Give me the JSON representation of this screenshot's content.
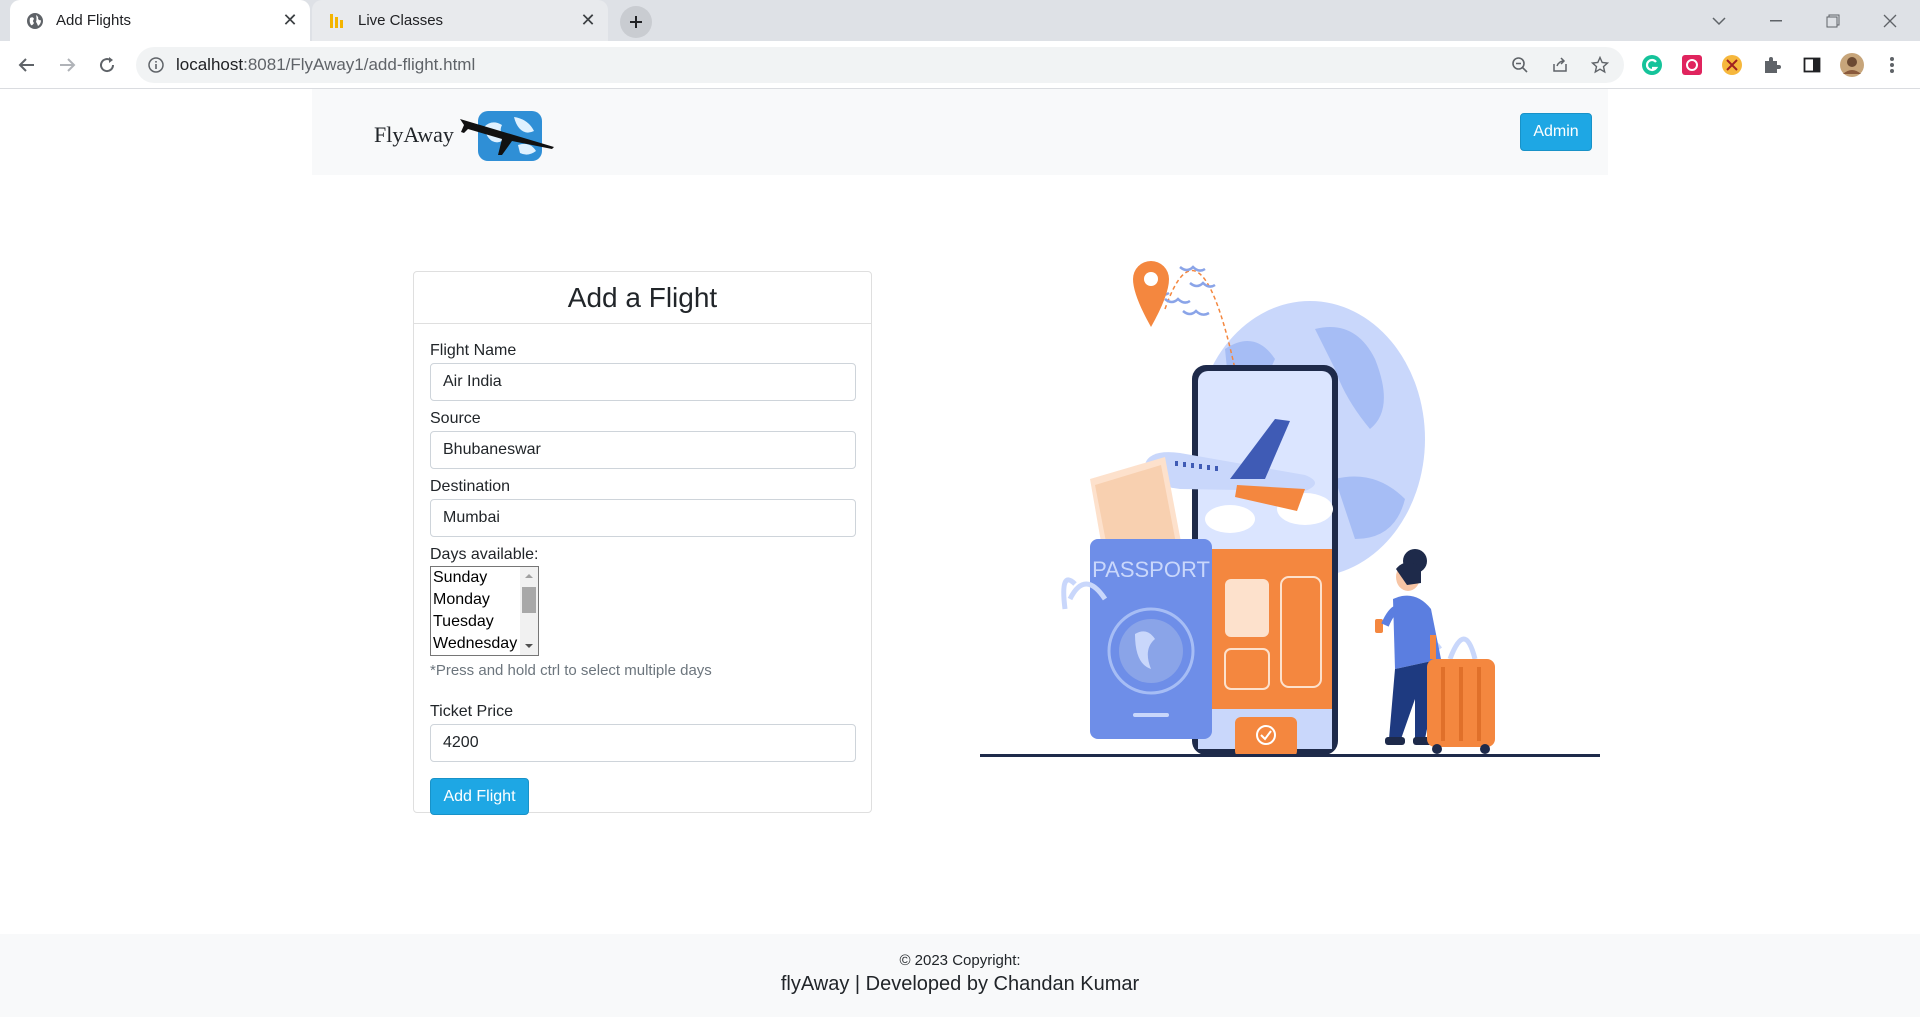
{
  "browser": {
    "tabs": [
      {
        "title": "Add Flights",
        "active": true
      },
      {
        "title": "Live Classes",
        "active": false
      }
    ],
    "url_host": "localhost",
    "url_path": ":8081/FlyAway1/add-flight.html"
  },
  "navbar": {
    "brand": "FlyAway",
    "admin_label": "Admin"
  },
  "form": {
    "title": "Add a Flight",
    "flight_name_label": "Flight Name",
    "flight_name_value": "Air India",
    "source_label": "Source",
    "source_value": "Bhubaneswar",
    "destination_label": "Destination",
    "destination_value": "Mumbai",
    "days_label": "Days available:",
    "days": [
      "Sunday",
      "Monday",
      "Tuesday",
      "Wednesday"
    ],
    "days_hint": "*Press and hold ctrl to select multiple days",
    "price_label": "Ticket Price",
    "price_value": "4200",
    "submit_label": "Add Flight"
  },
  "illustration": {
    "passport_text": "PASSPORT"
  },
  "footer": {
    "copyright": "© 2023 Copyright:",
    "developer": "flyAway | Developed by Chandan Kumar"
  },
  "colors": {
    "primary": "#1ea7e4",
    "orange": "#f4873f",
    "blue_light": "#b9c9f5",
    "navy": "#1e2a4a"
  }
}
